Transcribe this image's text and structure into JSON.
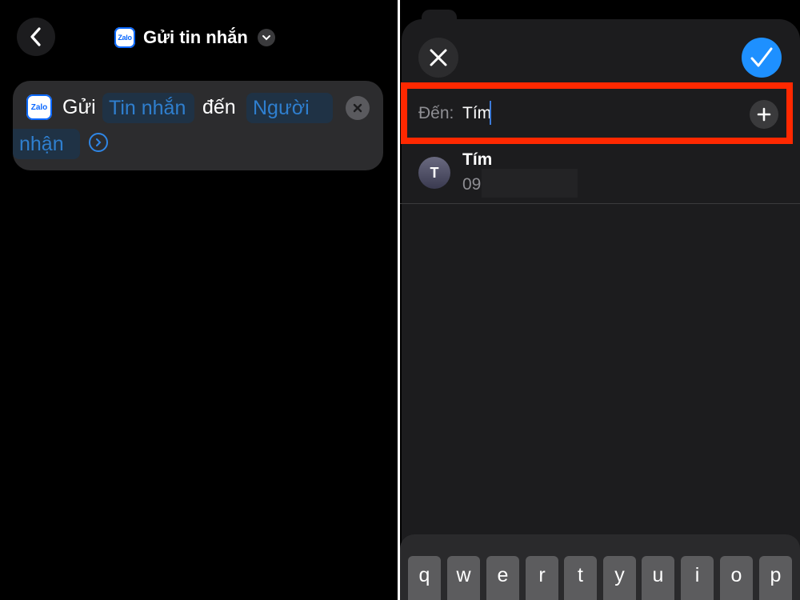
{
  "left": {
    "header": {
      "title": "Gửi tin nhắn",
      "app_icon_text": "Zalo"
    },
    "action": {
      "app_icon_text": "Zalo",
      "verb": "Gửi",
      "message_token": "Tin nhắn",
      "connector": "đến",
      "recipient_token_line1": "Người",
      "recipient_token_line2": "nhận"
    }
  },
  "right": {
    "to_label": "Đến:",
    "to_value": "Tím",
    "contact": {
      "initial": "T",
      "name": "Tím",
      "phone": "09"
    },
    "keyboard": {
      "keys": [
        "q",
        "w",
        "e",
        "r",
        "t",
        "y",
        "u",
        "i",
        "o",
        "p"
      ]
    },
    "accent_color": "#1e90ff",
    "highlight_color": "#ff2800"
  }
}
